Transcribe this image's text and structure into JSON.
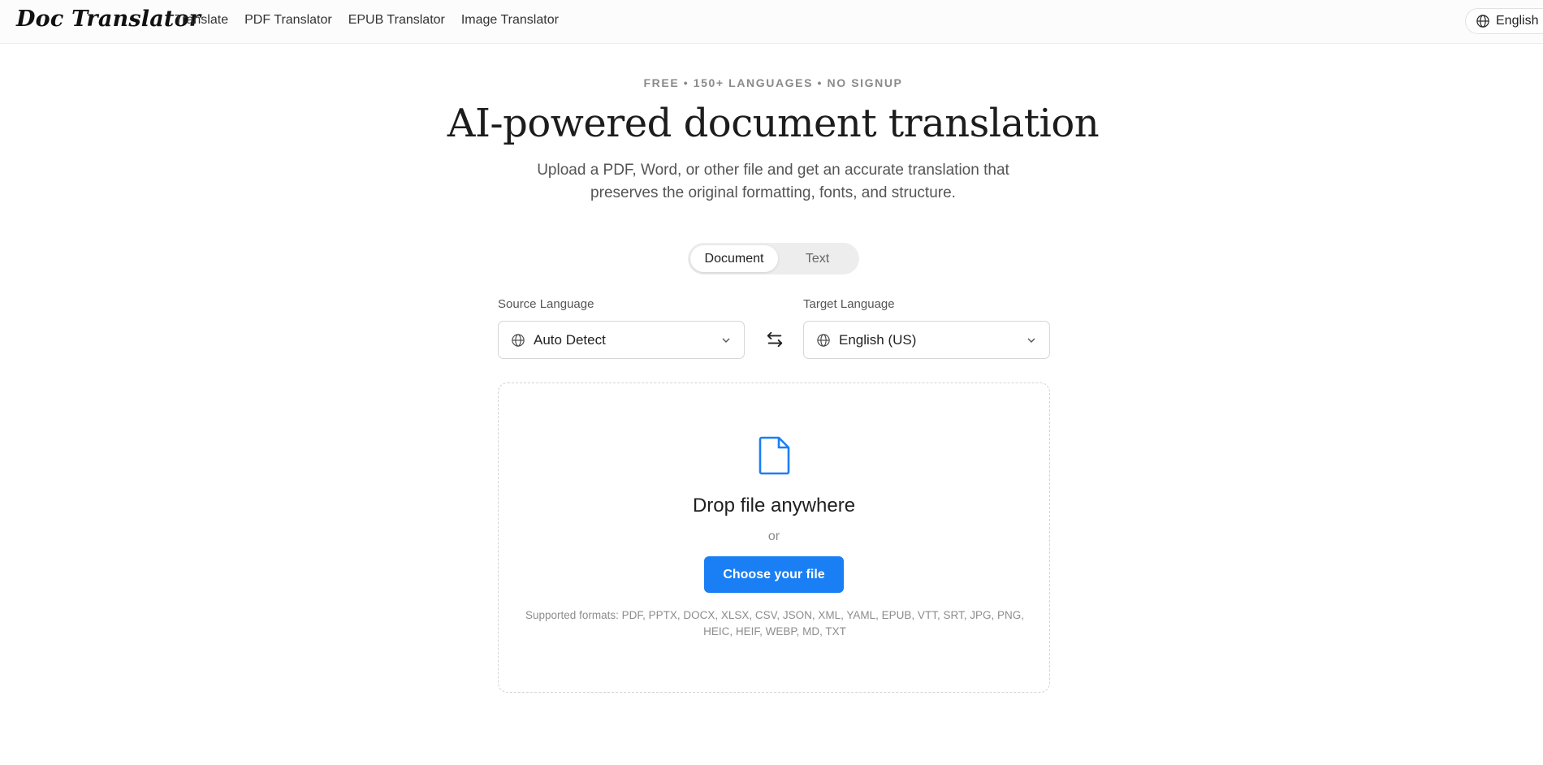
{
  "header": {
    "logo": "Doc Translator",
    "nav": [
      {
        "label": "Translate"
      },
      {
        "label": "PDF Translator"
      },
      {
        "label": "EPUB Translator"
      },
      {
        "label": "Image Translator"
      }
    ],
    "language_button": "English",
    "language_icon": "globe-icon"
  },
  "hero": {
    "eyebrow": "FREE • 150+ LANGUAGES • NO SIGNUP",
    "title": "AI-powered document translation",
    "subtitle": "Upload a PDF, Word, or other file and get an accurate translation that preserves the original formatting, fonts, and structure."
  },
  "mode_toggle": {
    "options": [
      "Document",
      "Text"
    ],
    "selected": "Document"
  },
  "languages": {
    "source_label": "Source Language",
    "source_value": "Auto Detect",
    "target_label": "Target Language",
    "target_value": "English (US)",
    "swap_icon": "swap-arrows-icon"
  },
  "upload": {
    "icon": "file-icon",
    "title": "Drop file anywhere",
    "or_text": "or",
    "button_label": "Choose your file",
    "formats_text": "Supported formats: PDF, PPTX, DOCX, XLSX, CSV, JSON, XML, YAML, EPUB, VTT, SRT, JPG, PNG, HEIC, HEIF, WEBP, MD, TXT"
  },
  "colors": {
    "accent": "#1a7ff5",
    "text": "#1f1f1f",
    "muted": "#8a8a8a"
  }
}
